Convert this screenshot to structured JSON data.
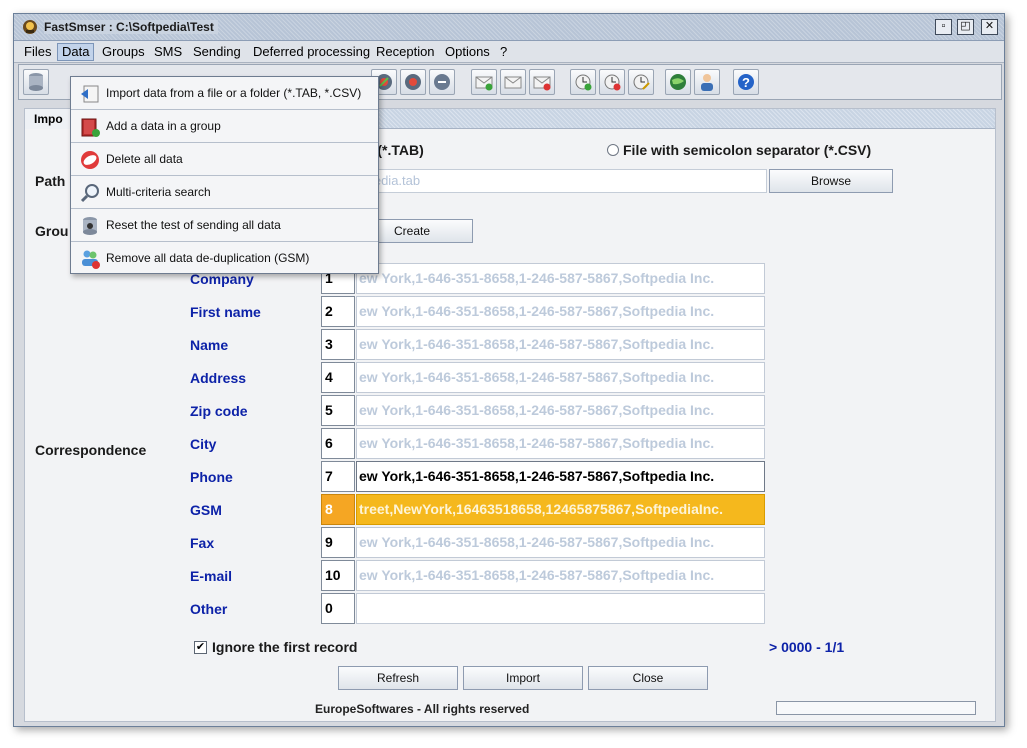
{
  "window": {
    "title": "FastSmser : C:\\Softpedia\\Test"
  },
  "menubar": {
    "items": [
      "Files",
      "Data",
      "Groups",
      "SMS",
      "Sending",
      "Deferred processing",
      "Reception",
      "Options",
      "?"
    ],
    "active": "Data"
  },
  "toolbar": {
    "icons": [
      "database-icon",
      "sms-send-icon",
      "sms-receive-icon",
      "sms-edit-icon",
      "envelope-add-icon",
      "envelope-send-icon",
      "envelope-remove-icon",
      "clock-add-icon",
      "clock-remove-icon",
      "clock-edit-icon",
      "globe-icon",
      "user-icon",
      "help-icon"
    ]
  },
  "dropdown": {
    "items": [
      {
        "label": "Import data from a file or a folder (*.TAB, *.CSV)",
        "icon": "import-icon"
      },
      {
        "label": "Add a data in a group",
        "icon": "book-add-icon"
      },
      {
        "label": "Delete all data",
        "icon": "delete-icon"
      },
      {
        "label": "Multi-criteria search",
        "icon": "magnifier-icon"
      },
      {
        "label": "Reset the test of sending all data",
        "icon": "reset-icon"
      },
      {
        "label": "Remove all data de-duplication (GSM)",
        "icon": "users-remove-icon"
      }
    ]
  },
  "panel": {
    "tab_label": "Impo",
    "format_tab_suffix": "r (*.TAB)",
    "format_csv": "File with semicolon separator (*.CSV)",
    "path_label": "Path",
    "path_value": "tpedia.tab",
    "browse_label": "Browse",
    "group_label": "Grou",
    "create_label": "Create",
    "correspondence_label": "Correspondence"
  },
  "fields": [
    {
      "label": "Company",
      "num": "1",
      "value": "ew York,1-646-351-8658,1-246-587-5867,Softpedia Inc.",
      "state": "normal"
    },
    {
      "label": "First name",
      "num": "2",
      "value": "ew York,1-646-351-8658,1-246-587-5867,Softpedia Inc.",
      "state": "normal"
    },
    {
      "label": "Name",
      "num": "3",
      "value": "ew York,1-646-351-8658,1-246-587-5867,Softpedia Inc.",
      "state": "normal"
    },
    {
      "label": "Address",
      "num": "4",
      "value": "ew York,1-646-351-8658,1-246-587-5867,Softpedia Inc.",
      "state": "normal"
    },
    {
      "label": "Zip code",
      "num": "5",
      "value": "ew York,1-646-351-8658,1-246-587-5867,Softpedia Inc.",
      "state": "normal"
    },
    {
      "label": "City",
      "num": "6",
      "value": "ew York,1-646-351-8658,1-246-587-5867,Softpedia Inc.",
      "state": "normal"
    },
    {
      "label": "Phone",
      "num": "7",
      "value": "ew York,1-646-351-8658,1-246-587-5867,Softpedia Inc.",
      "state": "active"
    },
    {
      "label": "GSM",
      "num": "8",
      "value": "treet,NewYork,16463518658,12465875867,SoftpediaInc.",
      "state": "selected"
    },
    {
      "label": "Fax",
      "num": "9",
      "value": "ew York,1-646-351-8658,1-246-587-5867,Softpedia Inc.",
      "state": "normal"
    },
    {
      "label": "E-mail",
      "num": "10",
      "value": "ew York,1-646-351-8658,1-246-587-5867,Softpedia Inc.",
      "state": "normal"
    },
    {
      "label": "Other",
      "num": "0",
      "value": "",
      "state": "normal"
    }
  ],
  "ignore_first": {
    "label": "Ignore the first record",
    "checked": true,
    "mark": "✔"
  },
  "record_counter": "> 0000 - 1/1",
  "buttons": {
    "refresh": "Refresh",
    "import": "Import",
    "close": "Close"
  },
  "footer": "EuropeSoftwares - All rights reserved",
  "colors": {
    "field_label": "#0d22a8",
    "selected_row": "#f5b81d",
    "counter": "#0d22a8"
  }
}
